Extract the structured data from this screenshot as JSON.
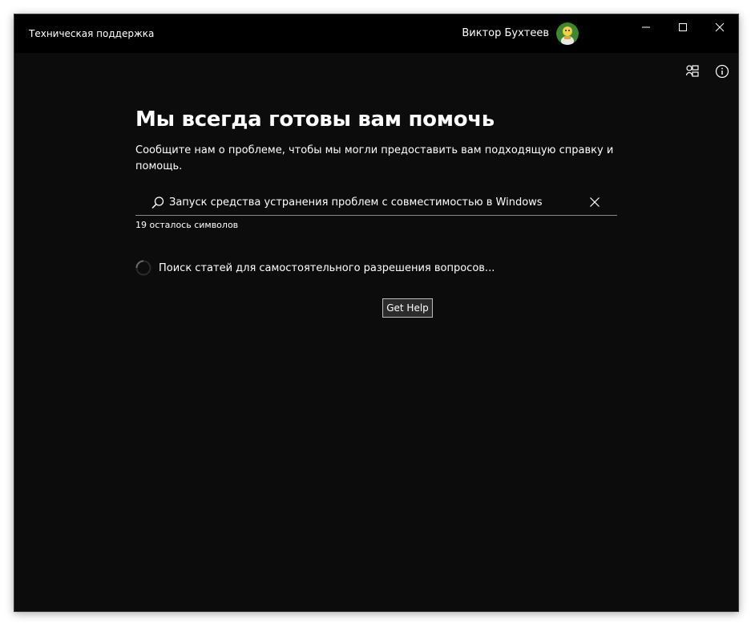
{
  "titlebar": {
    "app_title": "Техническая поддержка",
    "user_name": "Виктор Бухтеев",
    "avatar_icon": "user-avatar-icon",
    "controls": {
      "minimize_icon": "minimize-icon",
      "maximize_icon": "maximize-icon",
      "close_icon": "close-icon"
    }
  },
  "toolbar": {
    "share_icon": "share-screen-icon",
    "info_icon": "info-icon"
  },
  "main": {
    "heading": "Мы всегда готовы вам помочь",
    "subtitle": "Сообщите нам о проблеме, чтобы мы могли предоставить вам подходящую справку и помощь.",
    "search": {
      "value": "Запуск средства устранения проблем с совместимостью в Windows",
      "search_icon": "search-icon",
      "clear_icon": "close-icon"
    },
    "char_counter": "19 осталось символов",
    "loading_text": "Поиск статей для самостоятельного разрешения вопросов...",
    "get_help_label": "Get Help"
  },
  "colors": {
    "background": "#0c0c0c",
    "titlebar": "#000000",
    "text": "#ffffff",
    "button_bg": "#2b2b2b",
    "button_border": "#bdbdbd"
  }
}
